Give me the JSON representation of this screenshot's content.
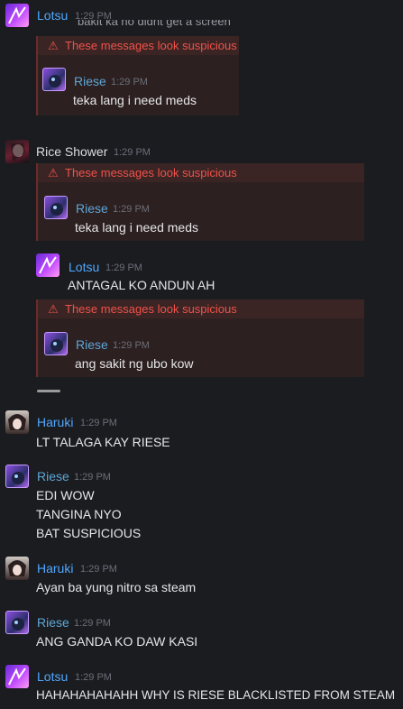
{
  "colors": {
    "background": "#1b1c20",
    "name_blue": "#50a8ff",
    "name_cyan": "#5ea6d6",
    "name_white": "#dcdddf",
    "warning": "#f0524a"
  },
  "warning_text": "These messages look suspicious",
  "warning_icon": "warning-triangle-icon",
  "messages": [
    {
      "author": "Lotsu",
      "time": "1:29 PM",
      "cut_text": "bakit ka no didnt get a screen",
      "quote": {
        "author": "Riese",
        "time": "1:29 PM",
        "text": "teka lang i need meds"
      }
    },
    {
      "author": "Rice Shower",
      "time": "1:29 PM",
      "quote": {
        "author": "Riese",
        "time": "1:29 PM",
        "text": "teka lang i need meds"
      }
    },
    {
      "author": "Lotsu",
      "time": "1:29 PM",
      "text": "ANTAGAL KO ANDUN AH",
      "quote": {
        "author": "Riese",
        "time": "1:29 PM",
        "text": "ang sakit ng ubo kow"
      }
    },
    {
      "author": "Haruki",
      "time": "1:29 PM",
      "lines": [
        "LT TALAGA KAY RIESE"
      ]
    },
    {
      "author": "Riese",
      "time": "1:29 PM",
      "lines": [
        "EDI WOW",
        "TANGINA NYO",
        "BAT SUSPICIOUS"
      ]
    },
    {
      "author": "Haruki",
      "time": "1:29 PM",
      "lines": [
        "Ayan ba yung nitro sa steam"
      ]
    },
    {
      "author": "Riese",
      "time": "1:29 PM",
      "lines": [
        "ANG GANDA KO DAW KASI"
      ]
    },
    {
      "author": "Lotsu",
      "time": "1:29 PM",
      "lines": [
        "HAHAHAHAHAHH WHY IS RIESE BLACKLISTED FROM STEAM"
      ]
    }
  ]
}
